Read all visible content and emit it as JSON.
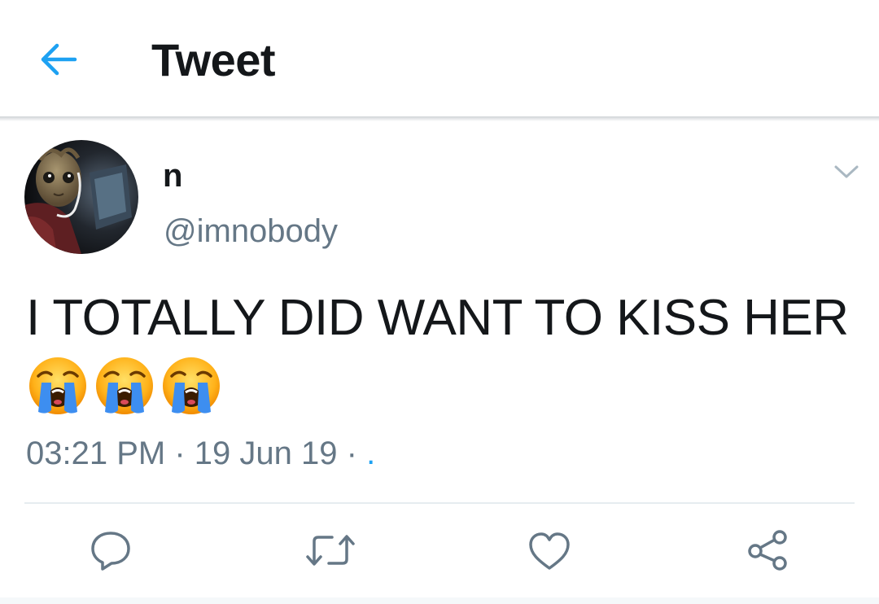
{
  "header": {
    "back_icon": "arrow-left-icon",
    "title": "Tweet"
  },
  "tweet": {
    "author": {
      "display_name": "n",
      "handle": "@imnobody",
      "avatar_icon": "groot-avatar"
    },
    "text": "I TOTALLY DID WANT TO KISS HER",
    "emojis": [
      "loudly-crying-face",
      "loudly-crying-face",
      "loudly-crying-face"
    ],
    "time": "03:21 PM",
    "date": "19 Jun 19",
    "source": ".",
    "separator": "·"
  },
  "actions": {
    "reply_icon": "reply-icon",
    "retweet_icon": "retweet-icon",
    "like_icon": "heart-icon",
    "share_icon": "share-icon"
  },
  "colors": {
    "accent": "#1da1f2",
    "text": "#14171a",
    "secondary": "#657786",
    "divider": "#e6ecf0"
  }
}
